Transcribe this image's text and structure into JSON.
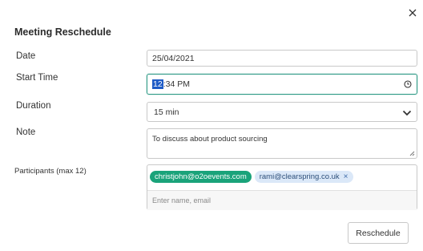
{
  "dialog": {
    "title": "Meeting Reschedule"
  },
  "fields": {
    "date_label": "Date",
    "date_value": "25/04/2021",
    "start_time_label": "Start Time",
    "start_time_hour": "12",
    "start_time_rest": ":34 PM",
    "duration_label": "Duration",
    "duration_value": "15 min",
    "note_label": "Note",
    "note_value": "To discuss about product sourcing",
    "participants_label": "Participants (max 12)",
    "participants": [
      {
        "email": "christjohn@o2oevents.com"
      },
      {
        "email": "rami@clearspring.co.uk",
        "remove": "×"
      }
    ],
    "participants_placeholder": "Enter name, email"
  },
  "actions": {
    "reschedule_label": "Reschedule"
  },
  "icons": {
    "close": "close-icon",
    "clock": "clock-icon",
    "chevron": "chevron-down-icon",
    "resize": "resize-grip-icon"
  },
  "colors": {
    "accent": "#2f9a86",
    "chip_green": "#1aa37a",
    "chip_blue": "#dbe8f8",
    "selection": "#1e5bc6"
  }
}
